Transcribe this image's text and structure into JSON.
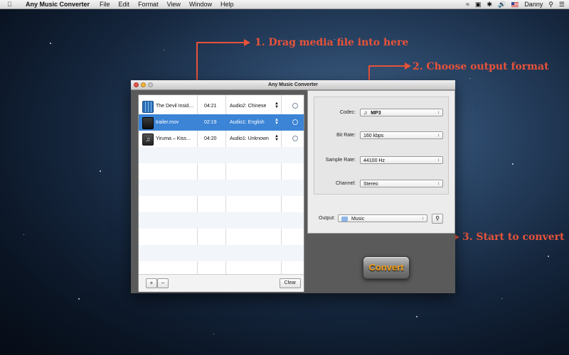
{
  "menubar": {
    "app_name": "Any Music Converter",
    "menus": [
      "File",
      "Edit",
      "Format",
      "View",
      "Window",
      "Help"
    ],
    "user": "Danny"
  },
  "annotations": {
    "step1": "1. Drag media file into here",
    "step2": "2. Choose output format",
    "step3": "3. Start to convert"
  },
  "window": {
    "title": "Any Music Converter"
  },
  "files": [
    {
      "name": "The Devil Insid…",
      "duration": "04:21",
      "audio": "Audio2: Chinese"
    },
    {
      "name": "trailer.mov",
      "duration": "02:19",
      "audio": "Audio1: English"
    },
    {
      "name": "Yiruma – Kiss…",
      "duration": "04:20",
      "audio": "Audio1: Unknown"
    }
  ],
  "list_controls": {
    "add_label": "+",
    "remove_label": "−",
    "clear_label": "Clear"
  },
  "settings": {
    "codec_label": "Codec:",
    "codec_value": "MP3",
    "bitrate_label": "Bit Rate:",
    "bitrate_value": "160 kbps",
    "samplerate_label": "Sample Rate:",
    "samplerate_value": "44100 Hz",
    "channel_label": "Channel:",
    "channel_value": "Stereo",
    "output_label": "Output:",
    "output_value": "Music"
  },
  "convert_label": "Convert",
  "colors": {
    "accent_annotation": "#e8533a",
    "selection": "#3b84d6",
    "convert_text": "#f7a21b"
  }
}
